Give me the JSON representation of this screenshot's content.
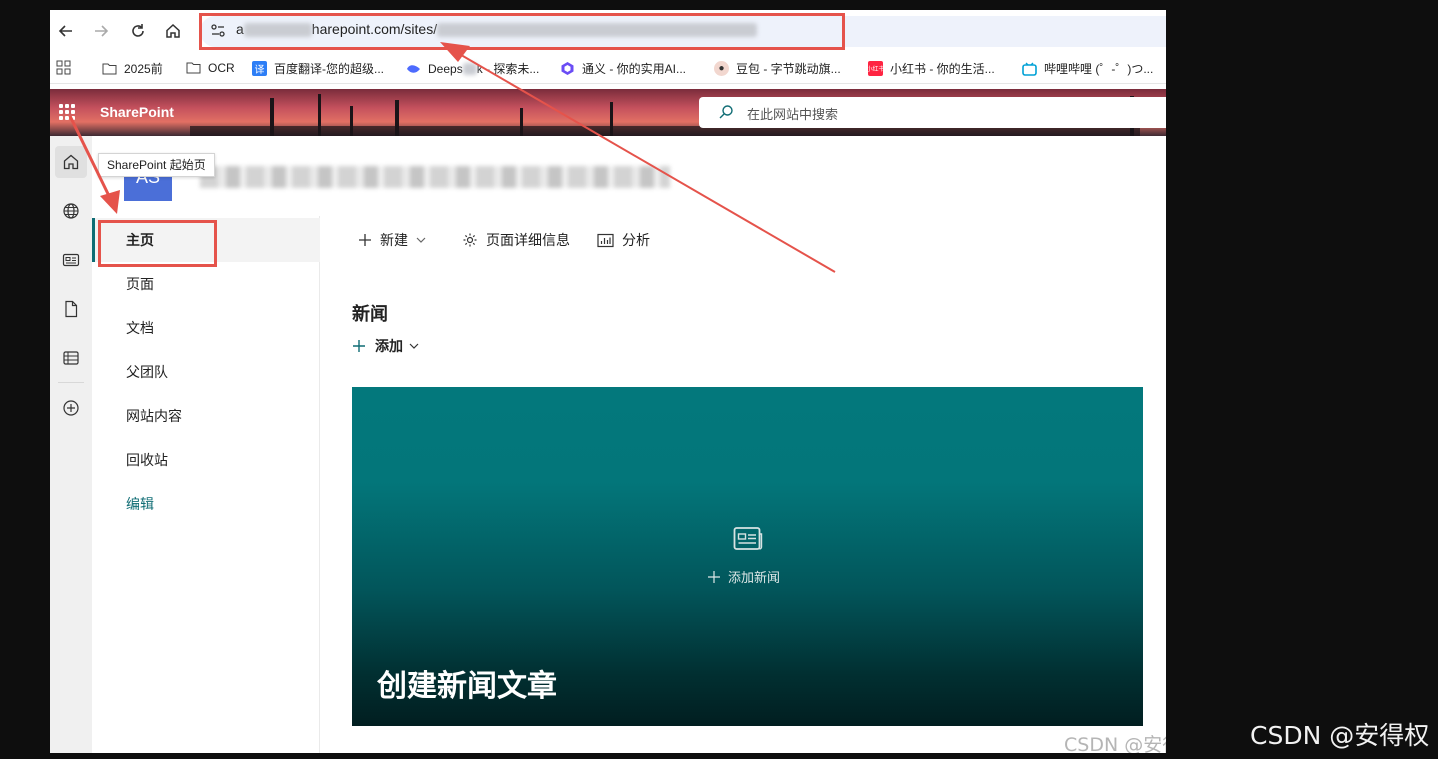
{
  "browser": {
    "url": {
      "prefix": "a",
      "middle": "harepoint.com/sites/"
    },
    "bookmarks": [
      {
        "label": "2025前",
        "icon": "folder-icon"
      },
      {
        "label": "OCR",
        "icon": "folder-icon"
      },
      {
        "label": "百度翻译-您的超级...",
        "icon": "baidu-translate-icon"
      },
      {
        "label": "k - 探索未...",
        "prefix": "Deeps",
        "icon": "deepseek-icon"
      },
      {
        "label": "通义 - 你的实用AI...",
        "icon": "tongyi-icon"
      },
      {
        "label": "豆包 - 字节跳动旗...",
        "icon": "doubao-icon"
      },
      {
        "label": "小红书 - 你的生活...",
        "icon": "xiaohongshu-icon"
      },
      {
        "label": "哔哩哔哩 (゜-゜)つ...",
        "icon": "bilibili-icon"
      }
    ]
  },
  "suite": {
    "brand": "SharePoint",
    "search_placeholder": "在此网站中搜索"
  },
  "rail": {
    "tooltip": "SharePoint 起始页"
  },
  "site": {
    "logo_text": "AS"
  },
  "sitenav": {
    "items": [
      "主页",
      "页面",
      "文档",
      "父团队",
      "网站内容",
      "回收站"
    ],
    "edit": "编辑"
  },
  "commandbar": {
    "new": "新建",
    "page_details": "页面详细信息",
    "analytics": "分析"
  },
  "news": {
    "heading": "新闻",
    "add": "添加",
    "card_add": "添加新闻",
    "card_title": "创建新闻文章"
  },
  "watermark": {
    "small": "CSDN @安得权",
    "large": "CSDN @安得权"
  },
  "colors": {
    "accent": "#0f6c74",
    "annotation": "#e5534b",
    "logo": "#4b6fd8"
  }
}
